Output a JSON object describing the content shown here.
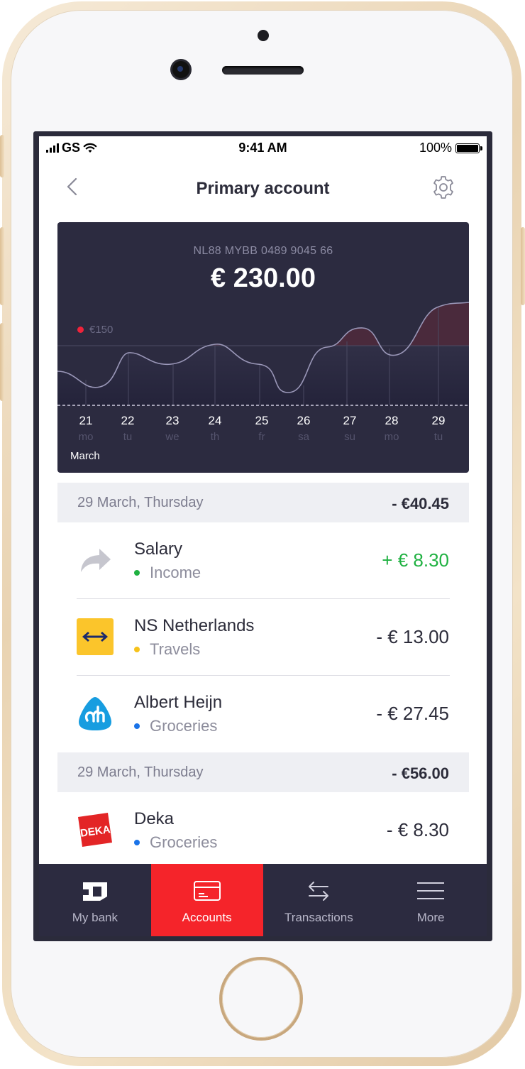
{
  "status_bar": {
    "carrier": "GS",
    "time": "9:41 AM",
    "battery": "100%"
  },
  "nav": {
    "title": "Primary account",
    "back_icon": "chevron-left-icon",
    "settings_icon": "gear-icon"
  },
  "account_card": {
    "iban": "NL88 MYBB 0489 9045 66",
    "balance": "€ 230.00",
    "limit_label": "€150",
    "month": "March",
    "days": [
      {
        "num": "21",
        "weekday": "mo"
      },
      {
        "num": "22",
        "weekday": "tu"
      },
      {
        "num": "23",
        "weekday": "we"
      },
      {
        "num": "24",
        "weekday": "th"
      },
      {
        "num": "25",
        "weekday": "fr"
      },
      {
        "num": "26",
        "weekday": "sa"
      },
      {
        "num": "27",
        "weekday": "su"
      },
      {
        "num": "28",
        "weekday": "mo"
      },
      {
        "num": "29",
        "weekday": "tu"
      }
    ],
    "colors": {
      "background": "#2c2b40",
      "limit": "#f0233a",
      "line": "#9a97b8"
    }
  },
  "transactions": {
    "groups": [
      {
        "date": "29 March, Thursday",
        "total": "- €40.45",
        "items": [
          {
            "name": "Salary",
            "category": "Income",
            "category_color": "#1fb141",
            "amount": "+ € 8.30",
            "icon": "share-arrow-icon"
          },
          {
            "name": "NS Netherlands",
            "category": "Travels",
            "category_color": "#f6c21b",
            "amount": "- € 13.00",
            "icon": "ns-logo-icon"
          },
          {
            "name": "Albert Heijn",
            "category": "Groceries",
            "category_color": "#1a73e8",
            "amount": "- € 27.45",
            "icon": "albert-heijn-logo-icon"
          }
        ]
      },
      {
        "date": "29 March, Thursday",
        "total": "- €56.00",
        "items": [
          {
            "name": "Deka",
            "category": "Groceries",
            "category_color": "#1a73e8",
            "amount": "- € 8.30",
            "icon": "deka-logo-icon"
          }
        ]
      }
    ]
  },
  "tabbar": {
    "tabs": [
      {
        "label": "My bank",
        "icon": "bank-logo-icon",
        "active": false
      },
      {
        "label": "Accounts",
        "icon": "card-icon",
        "active": true
      },
      {
        "label": "Transactions",
        "icon": "transfer-arrows-icon",
        "active": false
      },
      {
        "label": "More",
        "icon": "menu-icon",
        "active": false
      }
    ],
    "active_color": "#f5242a"
  }
}
